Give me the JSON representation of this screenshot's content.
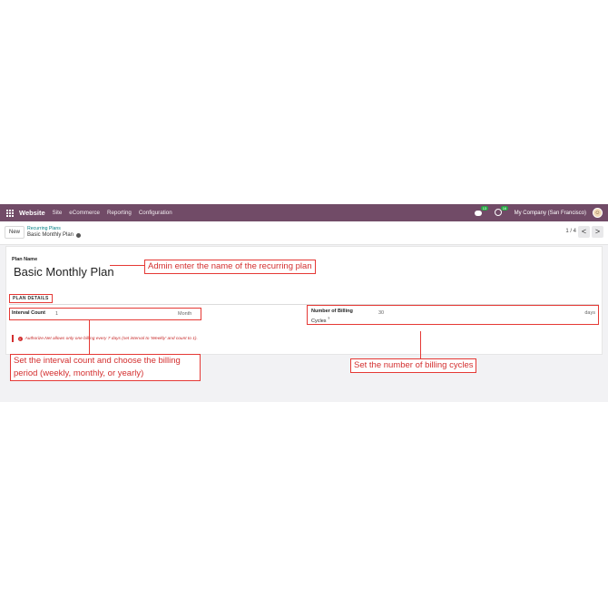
{
  "navbar": {
    "app_name": "Website",
    "menu": [
      "Site",
      "eCommerce",
      "Reporting",
      "Configuration"
    ],
    "chat_badge": "13",
    "activity_badge": "16",
    "company": "My Company (San Francisco)"
  },
  "control_panel": {
    "new_button": "New",
    "breadcrumb_parent": "Recurring Plans",
    "breadcrumb_current": "Basic Monthly Plan",
    "pager": "1 / 4",
    "prev": "<",
    "next": ">"
  },
  "form": {
    "plan_name_label": "Plan Name",
    "plan_name_value": "Basic Monthly Plan",
    "section_title": "PLAN DETAILS",
    "interval_count_label": "Interval Count",
    "interval_count_value": "1",
    "interval_unit": "Month",
    "billing_cycles_label_1": "Number of Billing",
    "billing_cycles_label_2": "Cycles",
    "billing_cycles_help": "?",
    "billing_cycles_value": "30",
    "billing_cycles_unit": "days",
    "warning_icon": "!",
    "warning_text": "Authorize.Net allows only one billing every 7 days (set interval to 'Weekly' and count to 1)."
  },
  "annotations": {
    "plan_name": "Admin enter the name of the recurring plan",
    "interval_line1": "Set the interval count and choose the billing",
    "interval_line2": "period (weekly, monthly, or yearly)",
    "billing_cycles": "Set the number of billing cycles"
  },
  "colors": {
    "navbar": "#714b67",
    "annotation": "#e53935"
  }
}
